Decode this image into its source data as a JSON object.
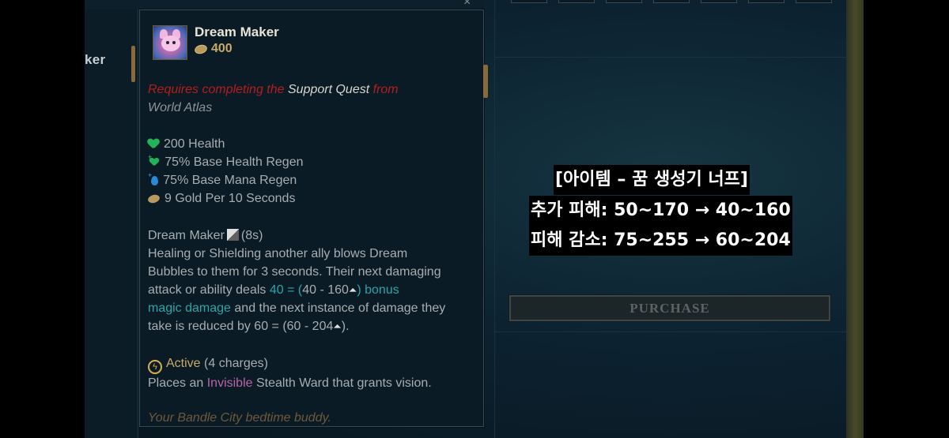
{
  "sidebar": {
    "item_partial": "ker"
  },
  "item": {
    "name": "Dream Maker",
    "price": "400",
    "requirement": {
      "part1": "Requires completing the",
      "quest": "Support Quest",
      "part2": "from",
      "source": "World Atlas"
    },
    "stats": [
      {
        "icon": "heart-icon",
        "text": "200 Health"
      },
      {
        "icon": "health-regen-icon",
        "text": "75% Base Health Regen"
      },
      {
        "icon": "mana-regen-icon",
        "text": "75% Base Mana Regen"
      },
      {
        "icon": "gold-icon",
        "text": "9 Gold Per 10 Seconds"
      }
    ],
    "passive": {
      "name": "Dream Maker",
      "cooldown": "(8s)",
      "line1": "Healing or Shielding another ally blows Dream",
      "line2": "Bubbles to them for 3 seconds. Their next damaging",
      "line3_a": "attack or ability deals",
      "line3_b": "40 = (",
      "line3_c": "40 - 160",
      "line3_d": ") bonus",
      "line4_a": "magic damage",
      "line4_b": "and the next instance of damage they",
      "line5_a": "take is reduced by 60 = (60 - 204",
      "line5_b": ")."
    },
    "active": {
      "label": "Active",
      "charges": "(4 charges)",
      "desc_a": "Places an",
      "desc_b": "Invisible",
      "desc_c": "Stealth Ward that grants vision."
    },
    "flavor": "Your Bandle City bedtime buddy."
  },
  "shop": {
    "purchase_label": "PURCHASE"
  },
  "captions": [
    "[아이템 – 꿈 생성기 너프]",
    "추가 피해: 50~170 → 40~160",
    "피해 감소: 75~255 → 60~204"
  ]
}
